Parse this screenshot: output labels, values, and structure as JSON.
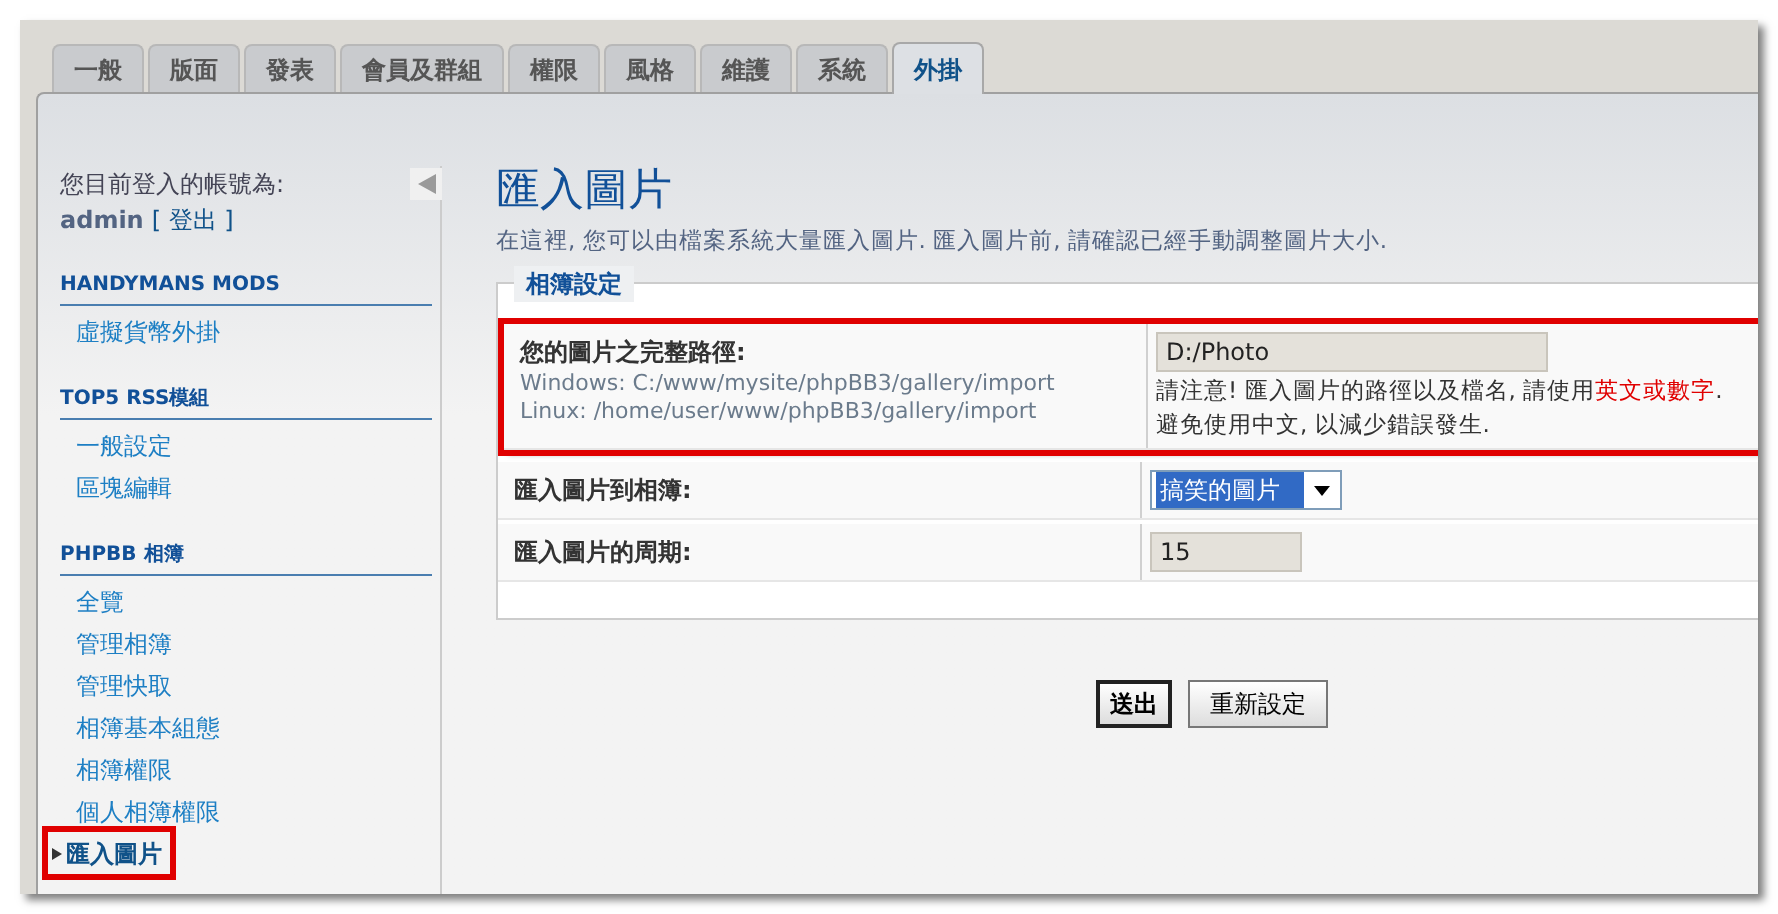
{
  "tabs": [
    {
      "label": "一般",
      "selected": false
    },
    {
      "label": "版面",
      "selected": false
    },
    {
      "label": "發表",
      "selected": false
    },
    {
      "label": "會員及群組",
      "selected": false
    },
    {
      "label": "權限",
      "selected": false
    },
    {
      "label": "風格",
      "selected": false
    },
    {
      "label": "維護",
      "selected": false
    },
    {
      "label": "系統",
      "selected": false
    },
    {
      "label": "外掛",
      "selected": true
    }
  ],
  "account": {
    "label": "您目前登入的帳號為:",
    "username": "admin",
    "logout": "[ 登出 ]"
  },
  "sidebar": {
    "sections": [
      {
        "title": "HANDYMANS MODS",
        "items": [
          {
            "label": "虛擬貨幣外掛",
            "selected": false,
            "highlighted": false
          }
        ]
      },
      {
        "title": "TOP5 RSS模組",
        "items": [
          {
            "label": "一般設定",
            "selected": false,
            "highlighted": false
          },
          {
            "label": "區塊編輯",
            "selected": false,
            "highlighted": false
          }
        ]
      },
      {
        "title": "PHPBB 相簿",
        "items": [
          {
            "label": "全覽",
            "selected": false,
            "highlighted": false
          },
          {
            "label": "管理相簿",
            "selected": false,
            "highlighted": false
          },
          {
            "label": "管理快取",
            "selected": false,
            "highlighted": false
          },
          {
            "label": "相簿基本組態",
            "selected": false,
            "highlighted": false
          },
          {
            "label": "相簿權限",
            "selected": false,
            "highlighted": false
          },
          {
            "label": "個人相簿權限",
            "selected": false,
            "highlighted": false
          },
          {
            "label": "匯入圖片",
            "selected": true,
            "highlighted": true
          }
        ]
      }
    ]
  },
  "page": {
    "title": "匯入圖片",
    "description": "在這裡, 您可以由檔案系統大量匯入圖片. 匯入圖片前, 請確認已經手動調整圖片大小."
  },
  "fieldset": {
    "legend": "相簿設定",
    "rows": [
      {
        "kind": "text",
        "label": "您的圖片之完整路徑:",
        "hints": [
          "Windows: C:/www/mysite/phpBB3/gallery/import",
          "Linux: /home/user/www/phpBB3/gallery/import"
        ],
        "value": "D:/Photo",
        "highlighted": true,
        "note": [
          {
            "text": "請注意! 匯入圖片的路徑以及檔名, 請使用",
            "emphasis": false
          },
          {
            "text": "英文或數字",
            "emphasis": true
          },
          {
            "text": ".",
            "emphasis": false
          }
        ],
        "note_2": "避免使用中文, 以減少錯誤發生."
      },
      {
        "kind": "select",
        "label": "匯入圖片到相簿:",
        "value": "搞笑的圖片",
        "highlighted": false
      },
      {
        "kind": "text",
        "label": "匯入圖片的周期:",
        "value": "15",
        "highlighted": false
      }
    ]
  },
  "buttons": [
    {
      "label": "送出",
      "primary": true
    },
    {
      "label": "重新設定",
      "primary": false
    }
  ]
}
